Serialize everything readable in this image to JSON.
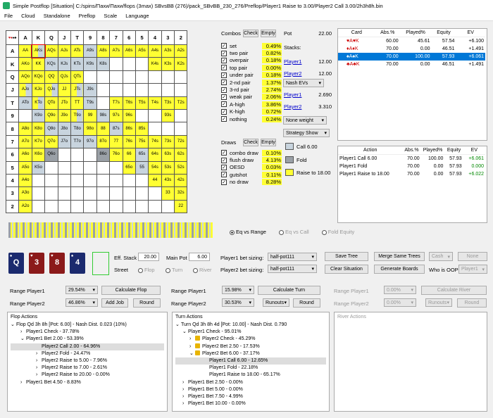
{
  "window": {
    "title": "Simple Postflop [Situation] C:/spins/Пахи/Пахи/flops (3max) SBvsBB (276)/pack_SBvBB_230_276/Preflop/Player1 Raise to 3.00/Player2 Call 3.00/2h3h8h.bin"
  },
  "menu": [
    "File",
    "Cloud",
    "Standalone",
    "Preflop",
    "Scale",
    "Language"
  ],
  "grid": {
    "ranks": [
      "A",
      "K",
      "Q",
      "J",
      "T",
      "9",
      "8",
      "7",
      "6",
      "5",
      "4",
      "3",
      "2"
    ],
    "rows": [
      [
        "AA",
        "AKs",
        "AQs",
        "AJs",
        "ATs",
        "A9s",
        "A8s",
        "A7s",
        "A6s",
        "A5s",
        "A4s",
        "A3s",
        "A2s"
      ],
      [
        "AKo",
        "KK",
        "KQs",
        "KJs",
        "KTs",
        "K9s",
        "K8s",
        "",
        "",
        "",
        "K4s",
        "K3s",
        "K2s"
      ],
      [
        "AQo",
        "KQo",
        "QQ",
        "QJs",
        "QTs",
        "",
        "",
        "",
        "",
        "",
        "",
        "",
        ""
      ],
      [
        "AJo",
        "KJo",
        "QJo",
        "JJ",
        "JTs",
        "J9s",
        "",
        "",
        "",
        "",
        "",
        "",
        ""
      ],
      [
        "ATo",
        "KTo",
        "QTo",
        "JTo",
        "TT",
        "T9s",
        "",
        "T7s",
        "T6s",
        "T5s",
        "T4s",
        "T3s",
        "T2s"
      ],
      [
        "",
        "K9o",
        "Q9o",
        "J9o",
        "T9o",
        "99",
        "98s",
        "97s",
        "96s",
        "",
        "",
        "93s",
        ""
      ],
      [
        "A8o",
        "K8o",
        "Q8o",
        "J8o",
        "T8o",
        "98o",
        "88",
        "87s",
        "86s",
        "85s",
        "",
        "",
        ""
      ],
      [
        "A7o",
        "K7o",
        "Q7o",
        "J7o",
        "T7o",
        "97o",
        "87o",
        "77",
        "76s",
        "75s",
        "74s",
        "73s",
        "72s"
      ],
      [
        "A6o",
        "K6o",
        "Q6o",
        "",
        "",
        "",
        "86o",
        "76o",
        "66",
        "65s",
        "64s",
        "63s",
        "62s"
      ],
      [
        "A5o",
        "K5o",
        "",
        "",
        "",
        "",
        "",
        "",
        "65o",
        "55",
        "54s",
        "53s",
        "52s"
      ],
      [
        "A4o",
        "",
        "",
        "",
        "",
        "",
        "",
        "",
        "",
        "",
        "44",
        "43s",
        "42s"
      ],
      [
        "A3o",
        "",
        "",
        "",
        "",
        "",
        "",
        "",
        "",
        "",
        "",
        "33",
        "32s"
      ],
      [
        "A2o",
        "",
        "",
        "",
        "",
        "",
        "",
        "",
        "",
        "",
        "",
        "",
        "22"
      ]
    ]
  },
  "combos": {
    "title": "Combos",
    "check": "Check",
    "empty": "Empty",
    "rows": [
      {
        "label": "set",
        "value": "0.49%",
        "pct": 0.05,
        "checked": true
      },
      {
        "label": "two pair",
        "value": "0.82%",
        "pct": 0.08,
        "checked": true
      },
      {
        "label": "overpair",
        "value": "0.18%",
        "pct": 0.6,
        "checked": true
      },
      {
        "label": "top pair",
        "value": "0.00%",
        "pct": 0.55,
        "checked": true
      },
      {
        "label": "under pair",
        "value": "0.18%",
        "pct": 0.5,
        "checked": true
      },
      {
        "label": "2-nd pair",
        "value": "1.37%",
        "pct": 0.45,
        "checked": true
      },
      {
        "label": "3-rd pair",
        "value": "2.74%",
        "pct": 0.4,
        "checked": true
      },
      {
        "label": "weak pair",
        "value": "2.06%",
        "pct": 0.3,
        "checked": true
      },
      {
        "label": "A-high",
        "value": "3.86%",
        "pct": 0.5,
        "checked": true
      },
      {
        "label": "K-high",
        "value": "0.72%",
        "pct": 0.45,
        "checked": true
      },
      {
        "label": "nothing",
        "value": "0.24%",
        "pct": 0.4,
        "checked": true
      }
    ]
  },
  "draws": {
    "title": "Draws",
    "check": "Check",
    "empty": "Empty",
    "rows": [
      {
        "label": "combo draw",
        "value": "0.10%",
        "pct": 0.05,
        "checked": true
      },
      {
        "label": "flush draw",
        "value": "4.13%",
        "pct": 0.4,
        "checked": true
      },
      {
        "label": "OESD",
        "value": "0.03%",
        "pct": 0.03,
        "checked": true
      },
      {
        "label": "gutshot",
        "value": "0.11%",
        "pct": 0.05,
        "checked": true
      },
      {
        "label": "no draw",
        "value": "8.28%",
        "pct": 0.5,
        "checked": true
      }
    ]
  },
  "pot": {
    "label": "Pot",
    "value": "22.00",
    "stacks": "Stacks:",
    "p1": "Player1",
    "p1v": "12.00",
    "p2": "Player2",
    "p2v": "12.00",
    "ev_sel": "Nash EVs",
    "p1b": "Player1",
    "p1bv": "2.690",
    "p2b": "Player2",
    "p2bv": "3.310",
    "weight_sel": "None weight",
    "strat_sel": "Strategy Show"
  },
  "legend": {
    "call": "Call 6.00",
    "fold": "Fold",
    "raise": "Raise to 18.00",
    "call_color": "#c8d4de",
    "fold_color": "#9aa0a6",
    "raise_color": "#ffff33"
  },
  "handtable": {
    "headers": [
      "Card",
      "Abs.%",
      "Played%",
      "Equity",
      "EV"
    ],
    "rows": [
      {
        "card": "♥A♥K",
        "abs": "60.00",
        "played": "45.61",
        "eq": "57.54",
        "ev": "+6.100",
        "sel": false
      },
      {
        "card": "♦A♦K",
        "abs": "70.00",
        "played": "0.00",
        "eq": "46.51",
        "ev": "+1.491",
        "sel": false
      },
      {
        "card": "♠A♠K",
        "abs": "70.00",
        "played": "100.00",
        "eq": "57.93",
        "ev": "+6.061",
        "sel": true
      },
      {
        "card": "♣A♣K",
        "abs": "70.00",
        "played": "0.00",
        "eq": "46.51",
        "ev": "+1.491",
        "sel": false
      }
    ]
  },
  "actiontable": {
    "headers": [
      "Action",
      "Abs.%",
      "Played%",
      "Equity",
      "EV"
    ],
    "rows": [
      {
        "action": "Player1 Call 6.00",
        "abs": "70.00",
        "played": "100.00",
        "eq": "57.93",
        "ev": "+6.061"
      },
      {
        "action": "Player1 Fold",
        "abs": "70.00",
        "played": "0.00",
        "eq": "57.93",
        "ev": "0.000"
      },
      {
        "action": "Player1 Raise to 18.00",
        "abs": "70.00",
        "played": "0.00",
        "eq": "57.93",
        "ev": "+6.022"
      }
    ]
  },
  "eqmode": {
    "a": "Eq vs Range",
    "b": "Eq vs Call",
    "c": "Fold Equity"
  },
  "board": {
    "cards": [
      {
        "rank": "Q",
        "suit": "♠",
        "color": "#1b2a6e"
      },
      {
        "rank": "3",
        "suit": "♥",
        "color": "#8b1a1a"
      },
      {
        "rank": "8",
        "suit": "♥",
        "color": "#8b1a1a"
      },
      {
        "rank": "4",
        "suit": "♠",
        "color": "#1b2a6e"
      }
    ],
    "eff_label": "Eff. Stack",
    "eff": "20.00",
    "main_label": "Main Pot",
    "main": "6.00",
    "street": "Street",
    "flop": "Flop",
    "turn": "Turn",
    "river": "River"
  },
  "sizing": {
    "p1": "Player1 bet sizing:",
    "p1v": "half-pot111",
    "p2": "Player2 bet sizing:",
    "p2v": "half-pot111",
    "save": "Save Tree",
    "merge": "Merge Same Trees",
    "cash": "Cash",
    "none": "None",
    "clear": "Clear Situation",
    "gen": "Generate Boards",
    "oop": "Who is OOP:",
    "oopv": "Player1"
  },
  "ranges": {
    "flop": {
      "p1": "Range Player1",
      "p1v": "29.54%",
      "calc": "Calculate Flop",
      "p2": "Range Player2",
      "p2v": "46.86%",
      "add": "Add Job",
      "round": "Round"
    },
    "turn": {
      "p1": "Range Player1",
      "p1v": "15.98%",
      "calc": "Calculate Turn",
      "p2": "Range Player2",
      "p2v": "30.53%",
      "runouts": "Runouts",
      "round": "Round"
    },
    "river": {
      "p1": "Range Player1",
      "p1v": "0.00%",
      "calc": "Calculate River",
      "p2": "Range Player2",
      "p2v": "0.00%",
      "runouts": "Runouts",
      "round": "Round"
    }
  },
  "flop_actions": {
    "title": "Flop Actions",
    "items": [
      "Flop Qd 3h 8h [Pot: 6.00] - Nash Dist. 0.023 (10%)",
      "Player1 Check - 37.78%",
      "Player1 Bet 2.00 - 53.39%",
      "Player2 Call 2.00 - 64.96%",
      "Player2 Fold - 24.47%",
      "Player2 Raise to 5.00 - 7.96%",
      "Player2 Raise to 7.00 - 2.61%",
      "Player2 Raise to 20.00 - 0.00%",
      "Player1 Bet 4.50 - 8.83%"
    ]
  },
  "turn_actions": {
    "title": "Turn Actions",
    "items": [
      "Turn Qd 3h 8h 4d [Pot: 10.00] - Nash Dist. 0.790",
      "Player1 Check - 95.01%",
      "Player2 Check - 45.29%",
      "Player2 Bet 2.50 - 17.53%",
      "Player2 Bet 6.00 - 37.17%",
      "Player1 Call 6.00 - 12.65%",
      "Player1 Fold - 22.18%",
      "Player1 Raise to 18.00 - 65.17%",
      "Player1 Bet 2.50 - 0.00%",
      "Player1 Bet 5.00 - 0.00%",
      "Player1 Bet 7.50 - 4.99%",
      "Player1 Bet 10.00 - 0.00%"
    ]
  },
  "river_actions": {
    "title": "River Actions"
  }
}
